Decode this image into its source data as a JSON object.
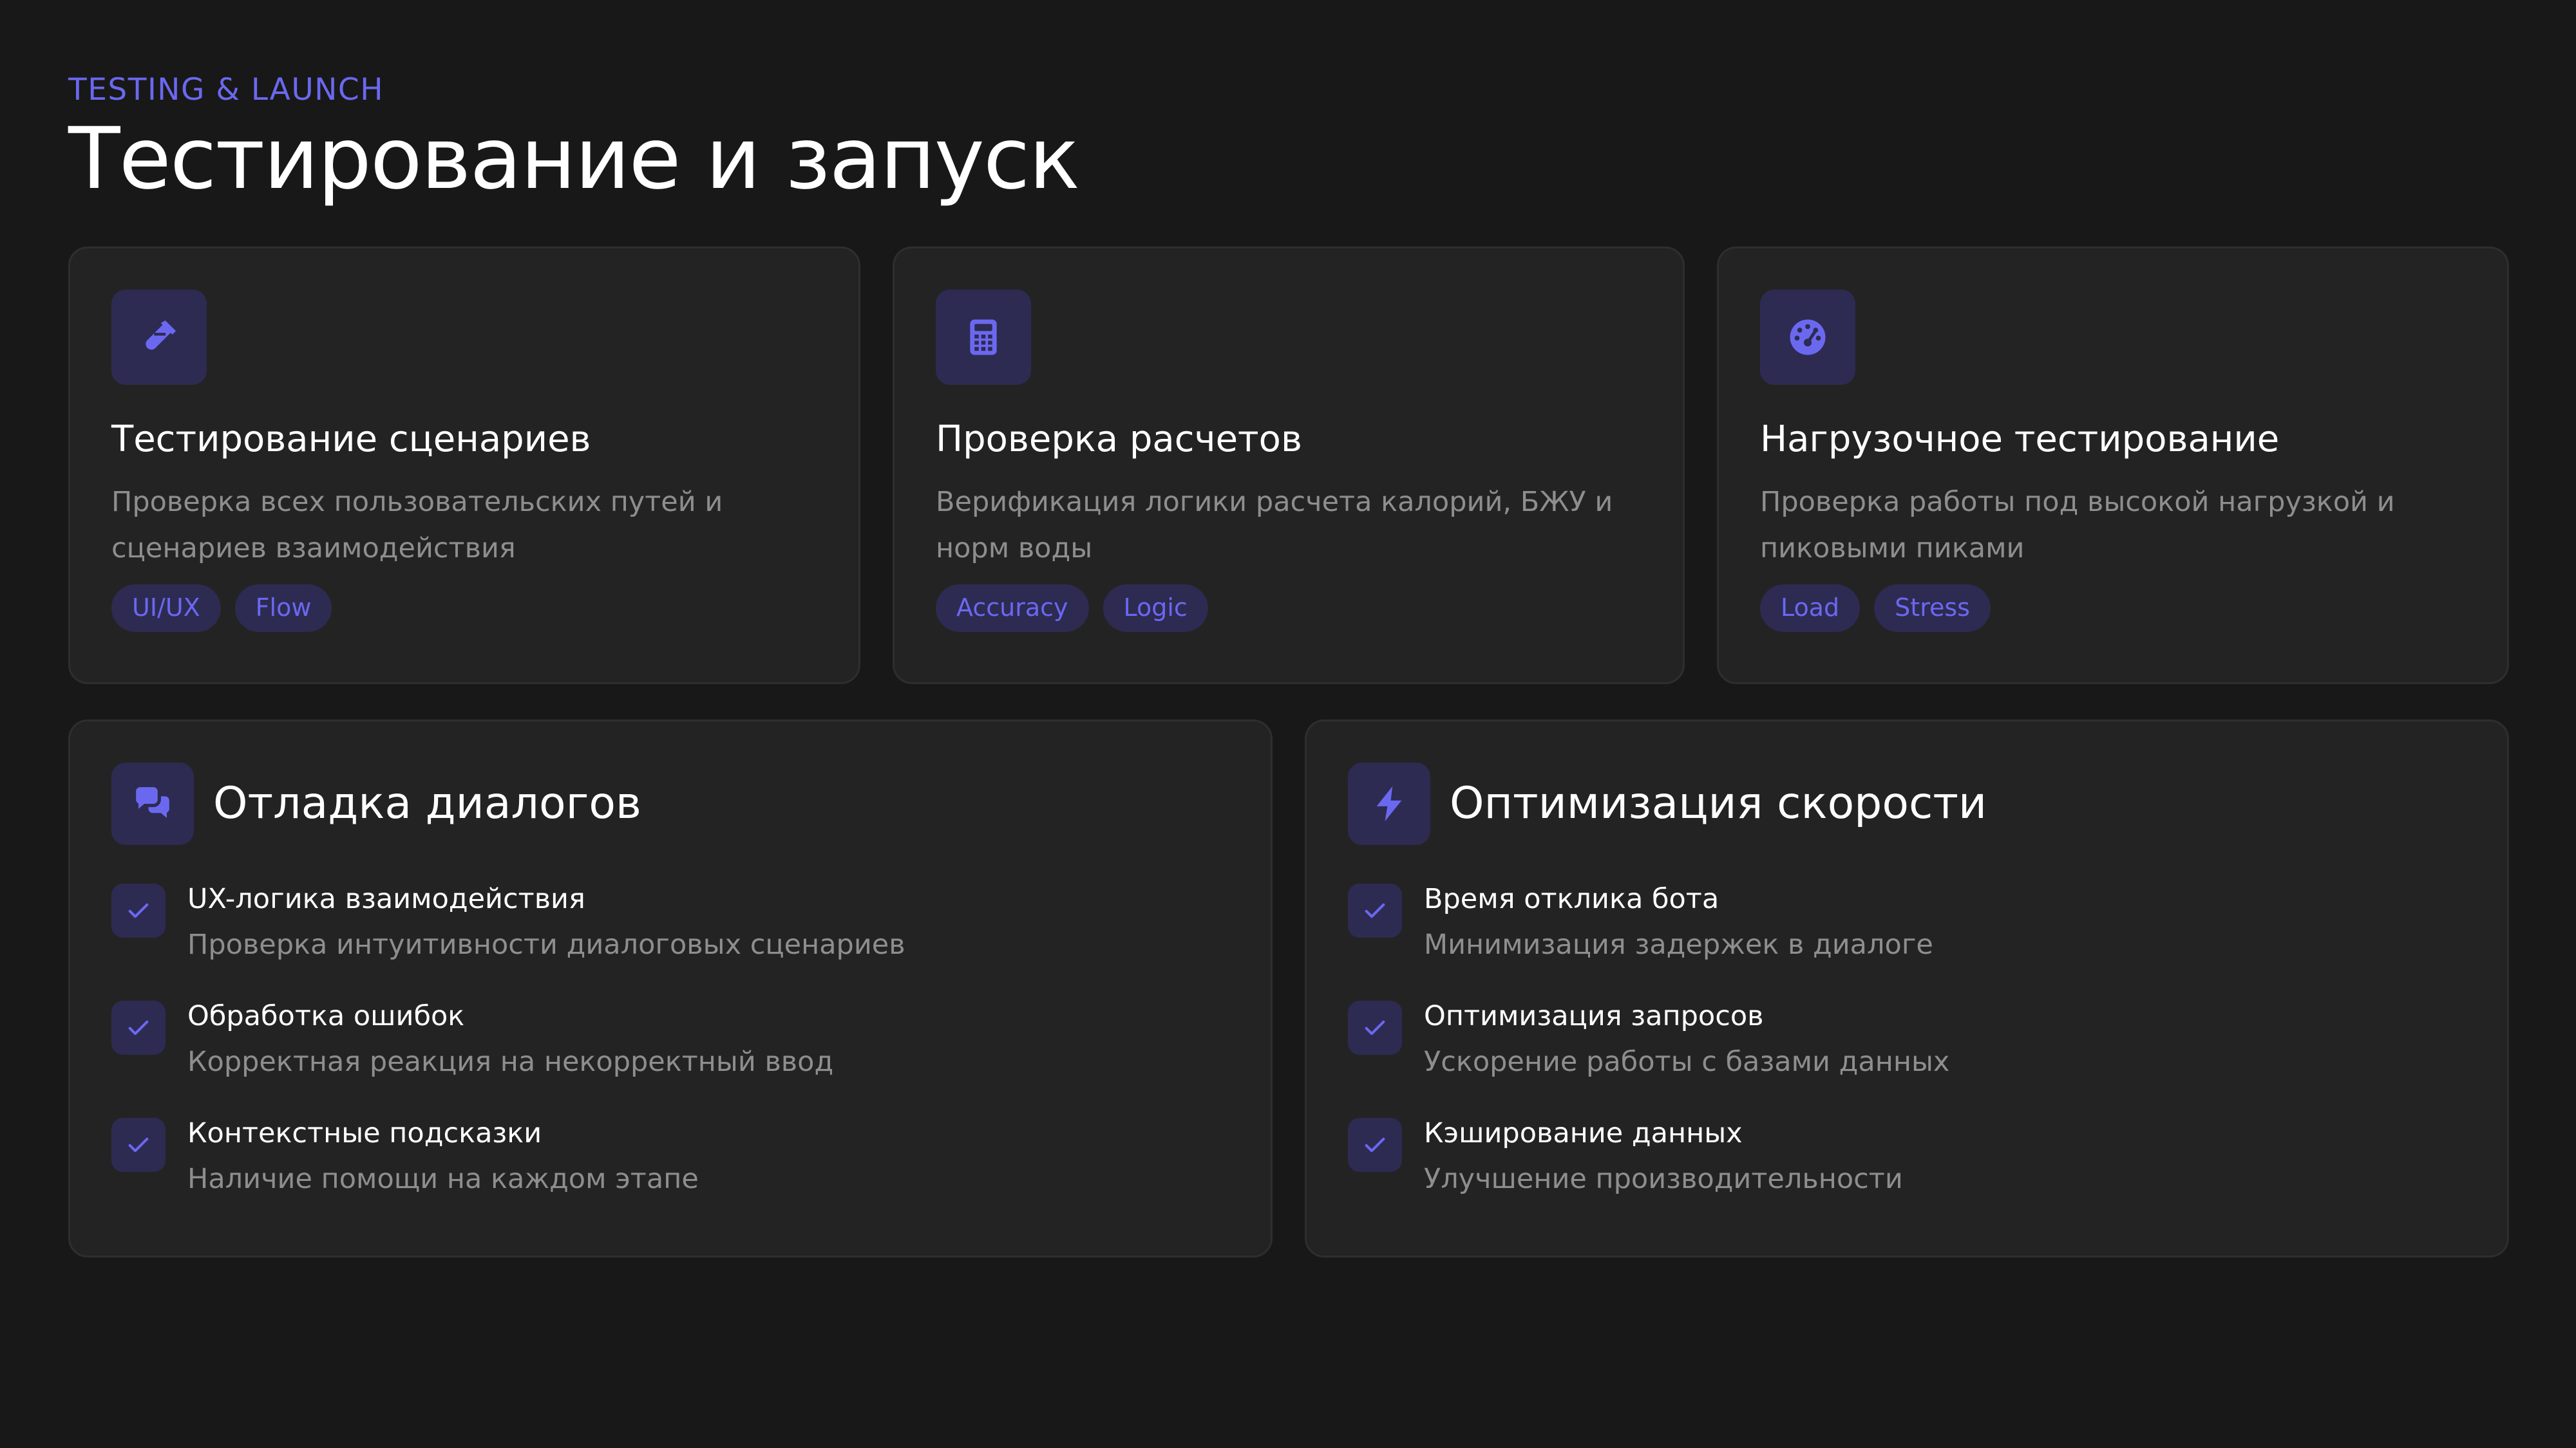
{
  "header": {
    "eyebrow": "TESTING & LAUNCH",
    "title": "Тестирование и запуск"
  },
  "colors": {
    "background": "#181818",
    "card": "#232323",
    "accent": "#6b68f0",
    "accent_bg": "#2d2b52",
    "text": "#ffffff",
    "muted": "#8e8e8e"
  },
  "cards": [
    {
      "icon": "test-tube-icon",
      "title": "Тестирование сценариев",
      "description": "Проверка всех пользовательских путей и сценариев взаимодействия",
      "tags": [
        "UI/UX",
        "Flow"
      ]
    },
    {
      "icon": "calculator-icon",
      "title": "Проверка расчетов",
      "description": "Верификация логики расчета калорий, БЖУ и норм воды",
      "tags": [
        "Accuracy",
        "Logic"
      ]
    },
    {
      "icon": "gauge-icon",
      "title": "Нагрузочное тестирование",
      "description": "Проверка работы под высокой нагрузкой и пиковыми пиками",
      "tags": [
        "Load",
        "Stress"
      ]
    }
  ],
  "sections": [
    {
      "icon": "chat-bubbles-icon",
      "title": "Отладка диалогов",
      "items": [
        {
          "title": "UX-логика взаимодействия",
          "description": "Проверка интуитивности диалоговых сценариев"
        },
        {
          "title": "Обработка ошибок",
          "description": "Корректная реакция на некорректный ввод"
        },
        {
          "title": "Контекстные подсказки",
          "description": "Наличие помощи на каждом этапе"
        }
      ]
    },
    {
      "icon": "lightning-bolt-icon",
      "title": "Оптимизация скорости",
      "items": [
        {
          "title": "Время отклика бота",
          "description": "Минимизация задержек в диалоге"
        },
        {
          "title": "Оптимизация запросов",
          "description": "Ускорение работы с базами данных"
        },
        {
          "title": "Кэширование данных",
          "description": "Улучшение производительности"
        }
      ]
    }
  ]
}
